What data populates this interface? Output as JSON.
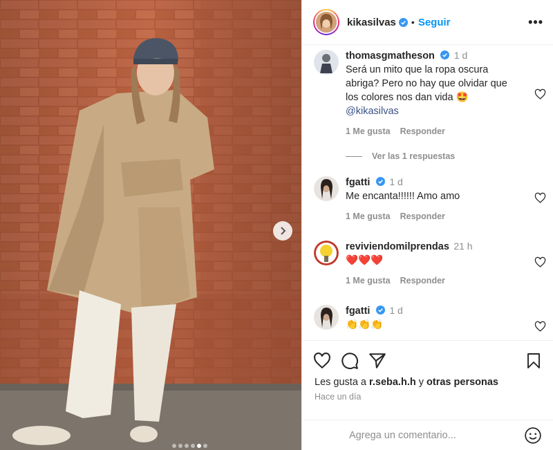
{
  "post": {
    "username": "kikasilvas",
    "separator": "•",
    "follow_label": "Seguir",
    "more_label": "•••"
  },
  "photo": {
    "carousel_dots": 6,
    "active_dot": 4
  },
  "comments": [
    {
      "username": "thomasgmatheson",
      "verified": true,
      "time": "1 d",
      "text": "Será un mito que la ropa oscura abriga? Pero no hay que olvidar que los colores nos dan vida 🤩",
      "mention": "@kikasilvas",
      "likes": "1 Me gusta",
      "reply_label": "Responder",
      "view_replies": "Ver las 1 respuestas"
    },
    {
      "username": "fgatti",
      "verified": true,
      "time": "1 d",
      "text": "Me encanta!!!!!! Amo amo",
      "likes": "1 Me gusta",
      "reply_label": "Responder"
    },
    {
      "username": "reviviendomilprendas",
      "verified": false,
      "time": "21 h",
      "text": "❤️❤️❤️",
      "likes": "1 Me gusta",
      "reply_label": "Responder"
    },
    {
      "username": "fgatti",
      "verified": true,
      "time": "1 d",
      "text": "👏👏👏"
    }
  ],
  "likes": {
    "prefix": "Les gusta a",
    "user": "r.seba.h.h",
    "conj": "y",
    "others": "otras personas"
  },
  "timestamp": "Hace un día",
  "compose": {
    "placeholder": "Agrega un comentario..."
  },
  "colors": {
    "link_blue": "#0095f6",
    "verified_blue": "#3897f0",
    "muted_gray": "#8e8e8e",
    "text_dark": "#262626"
  }
}
